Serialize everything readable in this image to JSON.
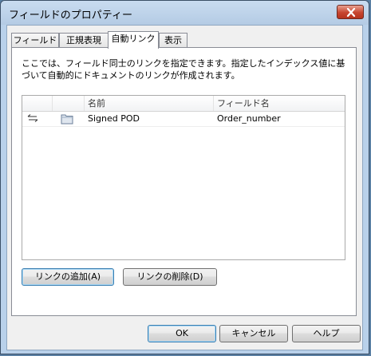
{
  "window": {
    "title": "フィールドのプロパティー"
  },
  "tabs": [
    {
      "label": "フィールド"
    },
    {
      "label": "正規表現"
    },
    {
      "label": "自動リンク"
    },
    {
      "label": "表示"
    }
  ],
  "active_tab": "自動リンク",
  "description": "ここでは、フィールド同士のリンクを指定できます。指定したインデックス値に基づいて自動的にドキュメントのリンクが作成されます。",
  "list": {
    "columns": [
      "",
      "",
      "名前",
      "フィールド名"
    ],
    "rows": [
      {
        "icon": "link-arrows-icon",
        "type_icon": "folder-icon",
        "name": "Signed POD",
        "field_name": "Order_number"
      }
    ]
  },
  "buttons": {
    "add_link": "リンクの追加(A)",
    "delete_link": "リンクの削除(D)",
    "ok": "OK",
    "cancel": "キャンセル",
    "help": "ヘルプ"
  }
}
